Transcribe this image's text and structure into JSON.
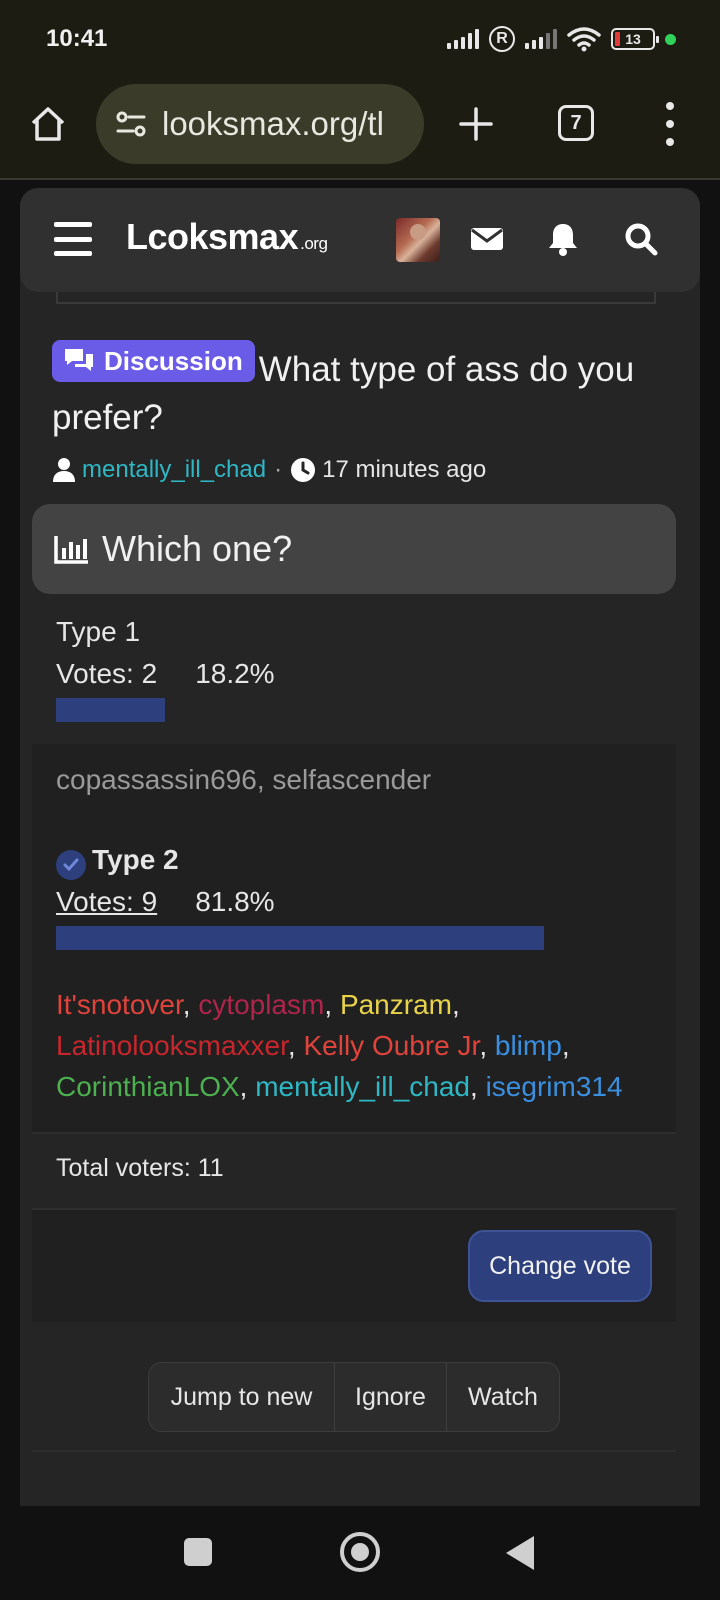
{
  "status_bar": {
    "time": "10:41",
    "battery": "13"
  },
  "browser": {
    "url": "looksmax.org/tl",
    "tab_count": "7"
  },
  "site": {
    "logo_main": "Lcoksmax",
    "logo_suffix": ".org"
  },
  "thread": {
    "prefix": "Discussion",
    "title": "What type of ass do you prefer?",
    "author": "mentally_ill_chad",
    "separator": "·",
    "time_ago": "17 minutes ago"
  },
  "poll": {
    "question": "Which one?",
    "options": [
      {
        "label": "Type 1",
        "votes_text": "Votes: 2",
        "percent_text": "18.2%",
        "percent": 18.2,
        "voters": [
          {
            "name": "copassassin696",
            "color": "#9a9a9a"
          },
          {
            "name": "selfascender",
            "color": "#9a9a9a"
          }
        ]
      },
      {
        "label": "Type 2",
        "votes_text": "Votes: 9",
        "percent_text": "81.8%",
        "percent": 81.8,
        "selected": true,
        "voters": [
          {
            "name": "It'snotover",
            "color": "#e0433b"
          },
          {
            "name": "cytoplasm",
            "color": "#b0244b"
          },
          {
            "name": "Panzram",
            "color": "#e8d34a"
          },
          {
            "name": "Latinolooksmaxxer",
            "color": "#c7262d"
          },
          {
            "name": "Kelly Oubre Jr",
            "color": "#e0433b"
          },
          {
            "name": "blimp",
            "color": "#3a8fe0"
          },
          {
            "name": "CorinthianLOX",
            "color": "#4caf50"
          },
          {
            "name": "mentally_ill_chad",
            "color": "#2fb7c4"
          },
          {
            "name": "isegrim314",
            "color": "#3a8fe0"
          }
        ]
      }
    ],
    "total_voters": "Total voters: 11",
    "change_vote_label": "Change vote"
  },
  "thread_actions": {
    "jump_to_new": "Jump to new",
    "ignore": "Ignore",
    "watch": "Watch"
  },
  "colors": {
    "accent": "#2d3f7d",
    "prefix_badge": "#6b5ce7",
    "link": "#2fb7c4"
  }
}
